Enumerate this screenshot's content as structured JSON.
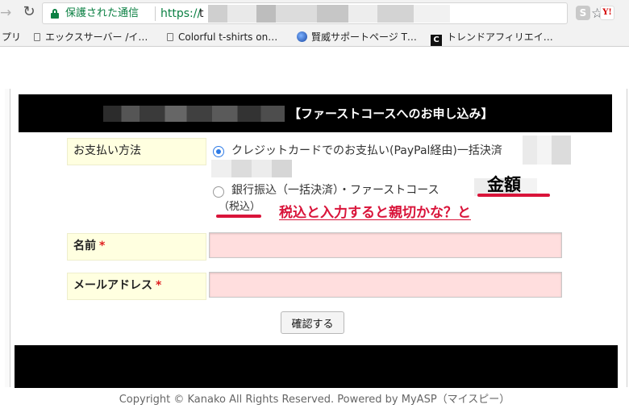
{
  "browser": {
    "secure_label": "保護された通信",
    "url_scheme": "https://",
    "url_host_visible": "t",
    "bookmarks": [
      {
        "label": "プリ"
      },
      {
        "label": "エックスサーバー /イ…"
      },
      {
        "label": "Colorful t-shirts on…"
      },
      {
        "label": "賢威サポートページ T…"
      },
      {
        "label": "トレンドアフィリエイ…"
      }
    ],
    "extensions": {
      "s": "S",
      "y": "Y!"
    }
  },
  "header": {
    "title": "【ファーストコースへのお申し込み】"
  },
  "form": {
    "payment": {
      "label": "お支払い方法",
      "options": [
        {
          "label": "クレジットカードでのお支払い(PayPal経由)一括決済",
          "selected": true
        },
        {
          "label": "銀行振込（一括決済）・ファーストコース",
          "selected": false
        }
      ],
      "tax_note": "（税込）"
    },
    "name": {
      "label": "名前",
      "required_mark": "*",
      "value": ""
    },
    "email": {
      "label": "メールアドレス",
      "required_mark": "*",
      "value": ""
    },
    "submit_label": "確認する"
  },
  "annotations": {
    "amount": "金額",
    "comment": "税込と入力すると親切かな？と",
    "color": "#d9143a"
  },
  "footer": {
    "copyright": "Copyright © Kanako All Rights Reserved. Powered by MyASP（マイスピー）"
  }
}
